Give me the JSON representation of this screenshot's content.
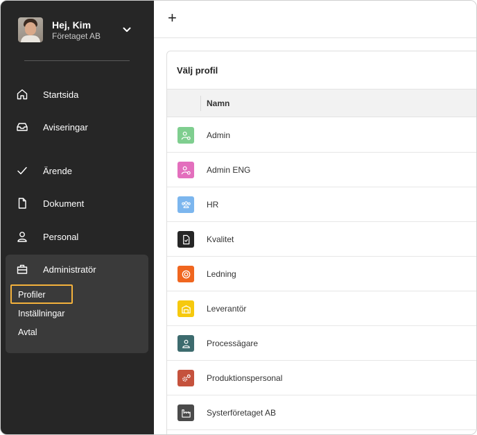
{
  "user": {
    "greeting": "Hej, Kim",
    "company": "Företaget AB"
  },
  "nav": {
    "items": [
      {
        "label": "Startsida",
        "icon": "home-icon"
      },
      {
        "label": "Aviseringar",
        "icon": "inbox-icon"
      },
      {
        "label": "Ärende",
        "icon": "check-icon"
      },
      {
        "label": "Dokument",
        "icon": "document-icon"
      },
      {
        "label": "Personal",
        "icon": "person-icon"
      },
      {
        "label": "Administratör",
        "icon": "briefcase-icon"
      }
    ],
    "admin_sub": [
      "Profiler",
      "Inställningar",
      "Avtal"
    ]
  },
  "topbar": {
    "add_label": "+"
  },
  "panel": {
    "title": "Välj profil",
    "column_name": "Namn",
    "rows": [
      {
        "name": "Admin",
        "color": "#7fce8f",
        "icon": "user-gear-icon"
      },
      {
        "name": "Admin ENG",
        "color": "#e36fbd",
        "icon": "user-gear-icon"
      },
      {
        "name": "HR",
        "color": "#7cb6ee",
        "icon": "users-icon"
      },
      {
        "name": "Kvalitet",
        "color": "#262626",
        "icon": "document-check-icon"
      },
      {
        "name": "Ledning",
        "color": "#f0661f",
        "icon": "lifebuoy-icon"
      },
      {
        "name": "Leverantör",
        "color": "#f6c90e",
        "icon": "warehouse-icon"
      },
      {
        "name": "Processägare",
        "color": "#3d6b6e",
        "icon": "person-icon"
      },
      {
        "name": "Produktionspersonal",
        "color": "#c5523d",
        "icon": "gears-icon"
      },
      {
        "name": "Systerföretaget AB",
        "color": "#4a4a4a",
        "icon": "factory-icon"
      }
    ]
  }
}
